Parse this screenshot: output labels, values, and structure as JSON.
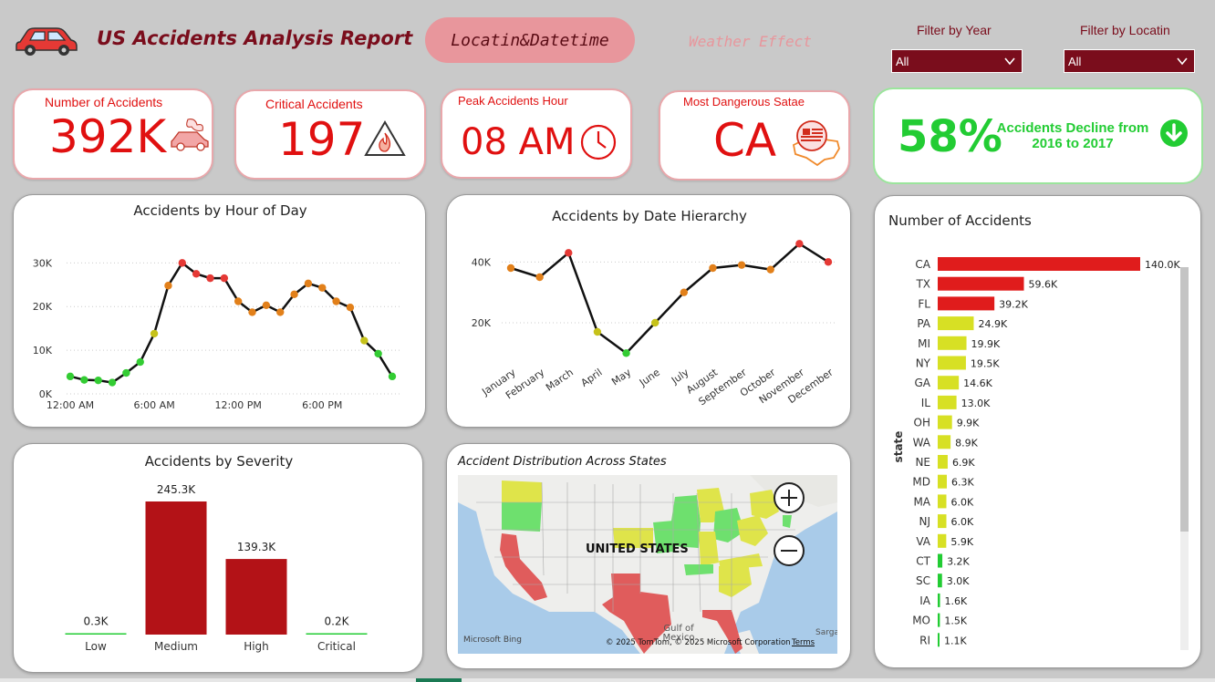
{
  "header": {
    "title": "US Accidents Analysis Report",
    "tab_active": "Locatin&Datetime",
    "tab_inactive": "Weather Effect"
  },
  "filters": {
    "year_label": "Filter by Year",
    "year_value": "All",
    "location_label": "Filter by Locatin",
    "location_value": "All"
  },
  "kpis": {
    "accidents": {
      "title": "Number of Accidents",
      "value": "392K"
    },
    "critical": {
      "title": "Critical Accidents",
      "value": "197"
    },
    "peak": {
      "title": "Peak Accidents Hour",
      "value": "08 AM"
    },
    "dangerous": {
      "title": "Most Dangerous Satae",
      "value": "CA"
    },
    "decline": {
      "value": "58%",
      "text": "Accidents Decline from 2016 to 2017"
    }
  },
  "colors": {
    "accent": "#e01010",
    "dark_red": "#7a0d1c",
    "green": "#22cc33",
    "bar_red": "#b31217",
    "bar_yellow": "#d7e024"
  },
  "map": {
    "title": "Accident Distribution Across States",
    "country_label": "UNITED STATES",
    "attribution": "© 2025 TomTom, © 2025 Microsoft Corporation",
    "terms": "Terms",
    "brand": "Microsoft Bing",
    "gulf": "Gulf of Mexico",
    "sarga": "Sarga"
  },
  "chart_data": [
    {
      "type": "line",
      "title": "Accidents by Hour of Day",
      "x": [
        0,
        1,
        2,
        3,
        4,
        5,
        6,
        7,
        8,
        9,
        10,
        11,
        12,
        13,
        14,
        15,
        16,
        17,
        18,
        19,
        20,
        21,
        22,
        23
      ],
      "values": [
        4000,
        3200,
        3100,
        2600,
        4800,
        7300,
        13800,
        24800,
        30000,
        27500,
        26500,
        26500,
        21200,
        18700,
        20300,
        18700,
        22800,
        25300,
        24300,
        21200,
        19800,
        12200,
        9200,
        4000
      ],
      "x_tick_labels": [
        "12:00 AM",
        "6:00 AM",
        "12:00 PM",
        "6:00 PM"
      ],
      "y_tick_labels": [
        "0K",
        "10K",
        "20K",
        "30K"
      ],
      "ylim": [
        0,
        33000
      ]
    },
    {
      "type": "line",
      "title": "Accidents by Date Hierarchy",
      "categories": [
        "January",
        "February",
        "March",
        "April",
        "May",
        "June",
        "July",
        "August",
        "September",
        "October",
        "November",
        "December"
      ],
      "values": [
        38000,
        35000,
        43000,
        17000,
        10000,
        20000,
        30000,
        38000,
        39000,
        37500,
        46000,
        40000
      ],
      "y_tick_labels": [
        "20K",
        "40K"
      ],
      "ylim": [
        5000,
        50000
      ]
    },
    {
      "type": "bar",
      "title": "Accidents by Severity",
      "categories": [
        "Low",
        "Medium",
        "High",
        "Critical"
      ],
      "values": [
        0.3,
        245.3,
        139.3,
        0.2
      ],
      "labels": [
        "0.3K",
        "245.3K",
        "139.3K",
        "0.2K"
      ]
    },
    {
      "type": "bar",
      "title": "Number of Accidents",
      "ylabel": "state",
      "categories": [
        "CA",
        "TX",
        "FL",
        "PA",
        "MI",
        "NY",
        "GA",
        "IL",
        "OH",
        "WA",
        "NE",
        "MD",
        "MA",
        "NJ",
        "VA",
        "CT",
        "SC",
        "IA",
        "MO",
        "RI"
      ],
      "values": [
        140.0,
        59.6,
        39.2,
        24.9,
        19.9,
        19.5,
        14.6,
        13.0,
        9.9,
        8.9,
        6.9,
        6.3,
        6.0,
        6.0,
        5.9,
        3.2,
        3.0,
        1.6,
        1.5,
        1.1
      ],
      "labels": [
        "140.0K",
        "59.6K",
        "39.2K",
        "24.9K",
        "19.9K",
        "19.5K",
        "14.6K",
        "13.0K",
        "9.9K",
        "8.9K",
        "6.9K",
        "6.3K",
        "6.0K",
        "6.0K",
        "5.9K",
        "3.2K",
        "3.0K",
        "1.6K",
        "1.5K",
        "1.1K"
      ]
    }
  ]
}
